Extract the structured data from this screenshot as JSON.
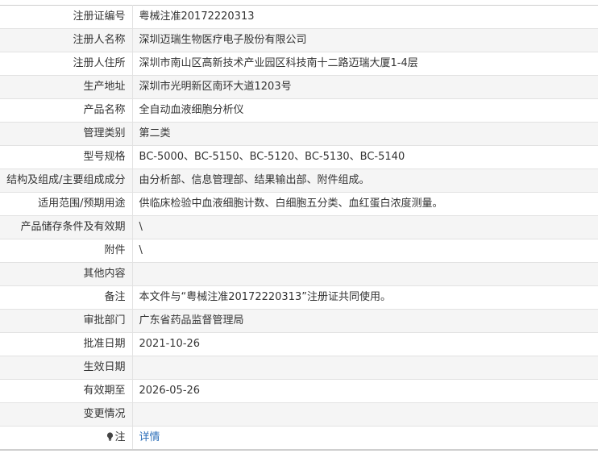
{
  "rows": [
    {
      "label": "注册证编号",
      "value": "粤械注准20172220313"
    },
    {
      "label": "注册人名称",
      "value": "深圳迈瑞生物医疗电子股份有限公司"
    },
    {
      "label": "注册人住所",
      "value": "深圳市南山区高新技术产业园区科技南十二路迈瑞大厦1-4层"
    },
    {
      "label": "生产地址",
      "value": "深圳市光明新区南环大道1203号"
    },
    {
      "label": "产品名称",
      "value": "全自动血液细胞分析仪"
    },
    {
      "label": "管理类别",
      "value": "第二类"
    },
    {
      "label": "型号规格",
      "value": "BC-5000、BC-5150、BC-5120、BC-5130、BC-5140"
    },
    {
      "label": "结构及组成/主要组成成分",
      "value": "由分析部、信息管理部、结果输出部、附件组成。"
    },
    {
      "label": "适用范围/预期用途",
      "value": "供临床检验中血液细胞计数、白细胞五分类、血红蛋白浓度测量。"
    },
    {
      "label": "产品储存条件及有效期",
      "value": "\\"
    },
    {
      "label": "附件",
      "value": "\\"
    },
    {
      "label": "其他内容",
      "value": ""
    },
    {
      "label": "备注",
      "value": "本文件与“粤械注准20172220313”注册证共同使用。"
    },
    {
      "label": "审批部门",
      "value": "广东省药品监督管理局"
    },
    {
      "label": "批准日期",
      "value": "2021-10-26"
    },
    {
      "label": "生效日期",
      "value": ""
    },
    {
      "label": "有效期至",
      "value": "2026-05-26"
    },
    {
      "label": "变更情况",
      "value": ""
    }
  ],
  "note": {
    "label": "注",
    "link_text": "详情",
    "icon": "lightbulb-icon"
  },
  "colors": {
    "border": "#e2e2e2",
    "alt_row": "#f5f5f5",
    "link": "#2a6db8"
  }
}
